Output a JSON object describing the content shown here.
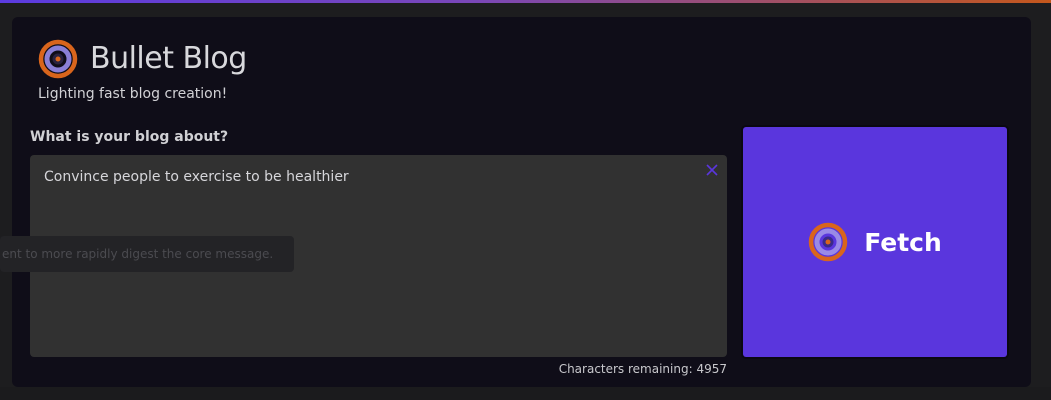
{
  "app": {
    "title": "Bullet Blog",
    "tagline": "Lighting fast blog creation!"
  },
  "form": {
    "question": "What is your blog about?",
    "textarea_value": "Convince people to exercise to be healthier",
    "char_count_text": "Characters remaining: 4957"
  },
  "fetch": {
    "label": "Fetch"
  },
  "background": {
    "ghost_text": "ent to more rapidly digest the core message."
  },
  "colors": {
    "accent": "#5a36dd",
    "logo_orange": "#d9651c",
    "panel_bg": "#0f0d18"
  },
  "icons": {
    "logo": "target-icon",
    "clear": "close-icon",
    "fetch": "target-icon"
  }
}
